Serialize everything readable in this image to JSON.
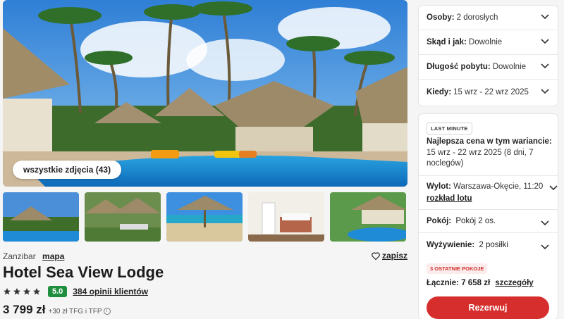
{
  "gallery": {
    "all_photos_label": "wszystkie zdjęcia (43)"
  },
  "hotel": {
    "region": "Zanzibar",
    "map_link": "mapa",
    "save_label": "zapisz",
    "name": "Hotel Sea View Lodge",
    "stars": 4,
    "rating": "5.0",
    "reviews_link": "384 opinii klientów",
    "price": "3 799 zł",
    "price_extra": "+30 zł TFG i TFP"
  },
  "filters": {
    "guests_label": "Osoby:",
    "guests_value": "2 dorosłych",
    "from_label": "Skąd i jak:",
    "from_value": "Dowolnie",
    "length_label": "Długość pobytu:",
    "length_value": "Dowolnie",
    "when_label": "Kiedy:",
    "when_value": "15 wrz - 22 wrz 2025"
  },
  "offer": {
    "badge": "LAST MINUTE",
    "best_title": "Najlepsza cena w tym wariancie:",
    "best_text": "15 wrz - 22 wrz 2025 (8 dni, 7 noclegów)",
    "flight_label": "Wylot:",
    "flight_value": "Warszawa-Okęcie, 11:20",
    "flight_link": "rozkład lotu",
    "room_label": "Pokój:",
    "room_value": "Pokój 2 os.",
    "board_label": "Wyżywienie:",
    "board_value": "2 posiłki",
    "last_rooms_badge": "3 OSTATNIE POKOJE",
    "total_label": "Łącznie:",
    "total_value": "7 658 zł",
    "details_link": "szczegóły",
    "reserve_label": "Rezerwuj"
  },
  "colors": {
    "accent_red": "#d62d2d",
    "rating_green": "#1f8f3f"
  }
}
